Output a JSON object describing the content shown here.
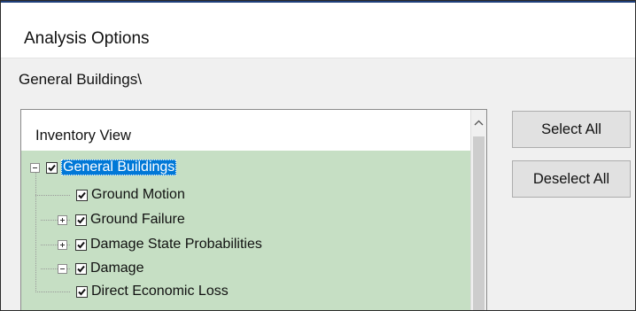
{
  "dialog": {
    "title": "Analysis Options",
    "path": "General Buildings\\"
  },
  "tree": {
    "header": "Inventory View",
    "nodes": [
      {
        "label": "General Buildings",
        "checked": true,
        "expander": "minus",
        "selected": true
      },
      {
        "label": "Ground Motion",
        "checked": true,
        "expander": "none",
        "selected": false
      },
      {
        "label": "Ground Failure",
        "checked": true,
        "expander": "plus",
        "selected": false
      },
      {
        "label": "Damage State Probabilities",
        "checked": true,
        "expander": "plus",
        "selected": false
      },
      {
        "label": "Damage",
        "checked": true,
        "expander": "minus",
        "selected": false
      },
      {
        "label": "Direct Economic Loss",
        "checked": true,
        "expander": "none",
        "selected": false
      }
    ]
  },
  "buttons": {
    "select_all": "Select All",
    "deselect_all": "Deselect All"
  },
  "colors": {
    "tree_background": "#c6dfc4",
    "selection": "#0078d7"
  }
}
